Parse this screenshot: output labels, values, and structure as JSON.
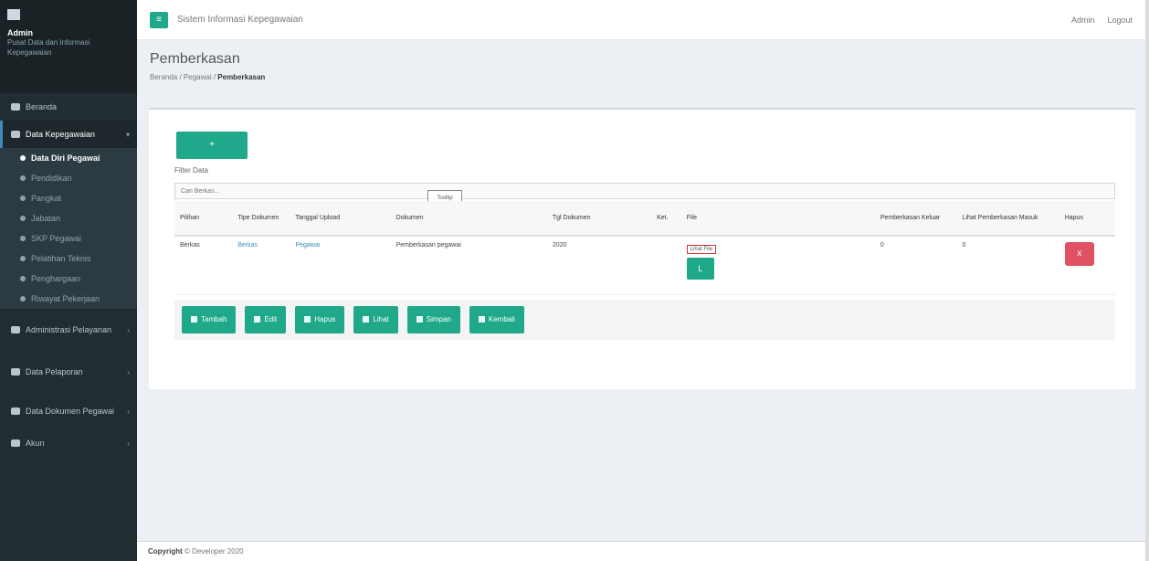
{
  "app": {
    "header_title": "Sistem Informasi Kepegawaian"
  },
  "sidebar": {
    "user_name": "Admin",
    "user_subtitle": "Pusat Data dan Informasi Kepegawaian",
    "items": [
      {
        "label": "Beranda"
      },
      {
        "label": "Data Kepegawaian",
        "expanded": true
      },
      {
        "label": "Data Diri Pegawai"
      },
      {
        "label": "Pendidikan"
      },
      {
        "label": "Pangkat"
      },
      {
        "label": "Jabatan"
      },
      {
        "label": "SKP Pegawai"
      },
      {
        "label": "Pelatihan Teknis"
      },
      {
        "label": "Penghargaan"
      },
      {
        "label": "Riwayat Pekerjaan"
      },
      {
        "label": "Administrasi Pelayanan"
      },
      {
        "label": "Data Pelaporan"
      },
      {
        "label": "Data Dokumen Pegawai"
      },
      {
        "label": "Akun"
      }
    ]
  },
  "topbar": {
    "user_label": "Admin",
    "logout_label": "Logout"
  },
  "header": {
    "title": "Pemberkasan",
    "crumbs": [
      "Beranda",
      "Pegawai",
      "Pemberkasan"
    ]
  },
  "box": {
    "add_button_icon": "+",
    "filter_label": "Filter Data",
    "filter_placeholder": "Cari Berkas...",
    "tooltip": "Tooltip",
    "columns": [
      "Pilihan",
      "Tipe Dokumen",
      "Tanggal Upload",
      "Dokumen",
      "Tgl Dokumen",
      "Ket.",
      "File",
      "Pemberkasan Keluar",
      "Lihat Pemberkasan Masuk",
      "Hapus"
    ],
    "row": {
      "pilihan": "Berkas",
      "tipe": "Berkas",
      "tanggal": "Pegawai",
      "dokumen": "Pemberkasan pegawai",
      "tgl": "2020",
      "ket": "",
      "file_name": "Lihat File",
      "file_btn": "L",
      "keluar": "0",
      "masuk": "0",
      "hapus_icon": "x"
    },
    "actions": [
      {
        "label": "Tambah"
      },
      {
        "label": "Edit"
      },
      {
        "label": "Hapus"
      },
      {
        "label": "Lihat"
      },
      {
        "label": "Simpan"
      },
      {
        "label": "Kembali"
      }
    ]
  },
  "footer": {
    "label": "Copyright",
    "text": "© Developer 2020"
  },
  "colors": {
    "accent": "#1fa88a",
    "danger": "#e05263",
    "sidebar": "#222d32"
  }
}
